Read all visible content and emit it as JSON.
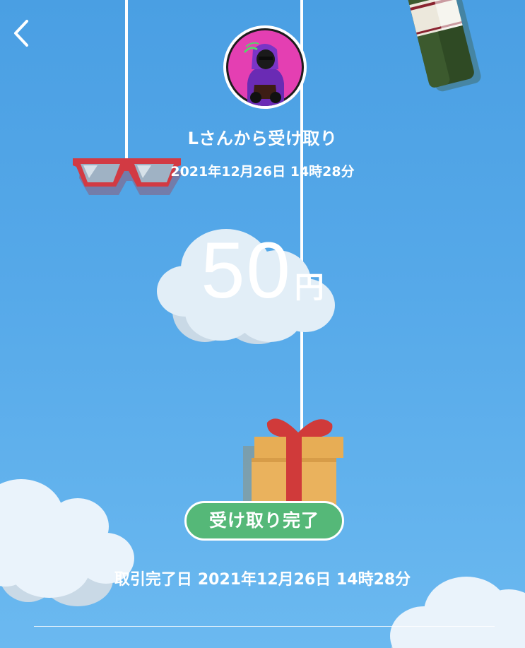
{
  "header": {
    "back_icon": "chevron-left-icon",
    "avatar_alt": "sender avatar"
  },
  "transfer": {
    "sender_title": "Lさんから受け取り",
    "received_datetime": "2021年12月26日 14時28分",
    "amount_value": "50",
    "amount_unit": "円",
    "status_label": "受け取り完了",
    "completed_label": "取引完了日",
    "completed_datetime": "2021年12月26日 14時28分"
  },
  "colors": {
    "background_top": "#4a9fe3",
    "background_bottom": "#6bb9f0",
    "status_green": "#55b878",
    "text": "#ffffff"
  },
  "decorations": [
    "glasses-decoration",
    "bottle-decoration",
    "cloud-decoration",
    "gift-box-decoration"
  ]
}
